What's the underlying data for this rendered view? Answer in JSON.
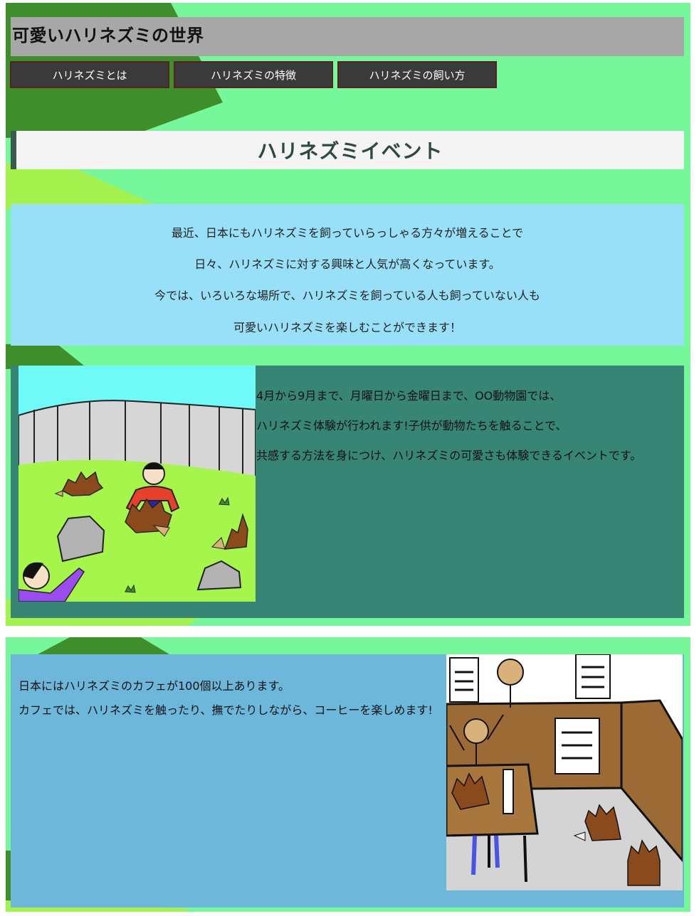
{
  "header": {
    "title": "可愛いハリネズミの世界"
  },
  "nav": {
    "items": [
      {
        "label": "ハリネズミとは"
      },
      {
        "label": "ハリネズミの特徴"
      },
      {
        "label": "ハリネズミの飼い方"
      }
    ]
  },
  "section": {
    "heading": "ハリネズミイベント"
  },
  "intro": {
    "lines": [
      "最近、日本にもハリネズミを飼っていらっしゃる方々が増えることで",
      "日々、ハリネズミに対する興味と人気が高くなっています。",
      "今では、いろいろな場所で、ハリネズミを飼っている人も飼っていない人も",
      "可愛いハリネズミを楽しむことができます！"
    ]
  },
  "event": {
    "paragraphs": [
      "4月から9月まで、月曜日から金曜日まで、OO動物園では、",
      "ハリネズミ体験が行われます!子供が動物たちを触ることで、",
      "共感する方法を身につけ、ハリネズミの可愛さも体験できるイベントです。"
    ]
  },
  "cafe": {
    "paragraphs": [
      "日本にはハリネズミのカフェが100個以上あります。",
      "カフェでは、ハリネズミを触ったり、撫でたりしながら、コーヒーを楽しめます!"
    ]
  },
  "colors": {
    "panel_bg": "#76f79a",
    "header_bg": "#a8a8a8",
    "nav_bg": "#3a3a3a",
    "intro_bg": "#97e0f7",
    "event_bg": "#378574",
    "cafe_bg": "#6db8da"
  }
}
